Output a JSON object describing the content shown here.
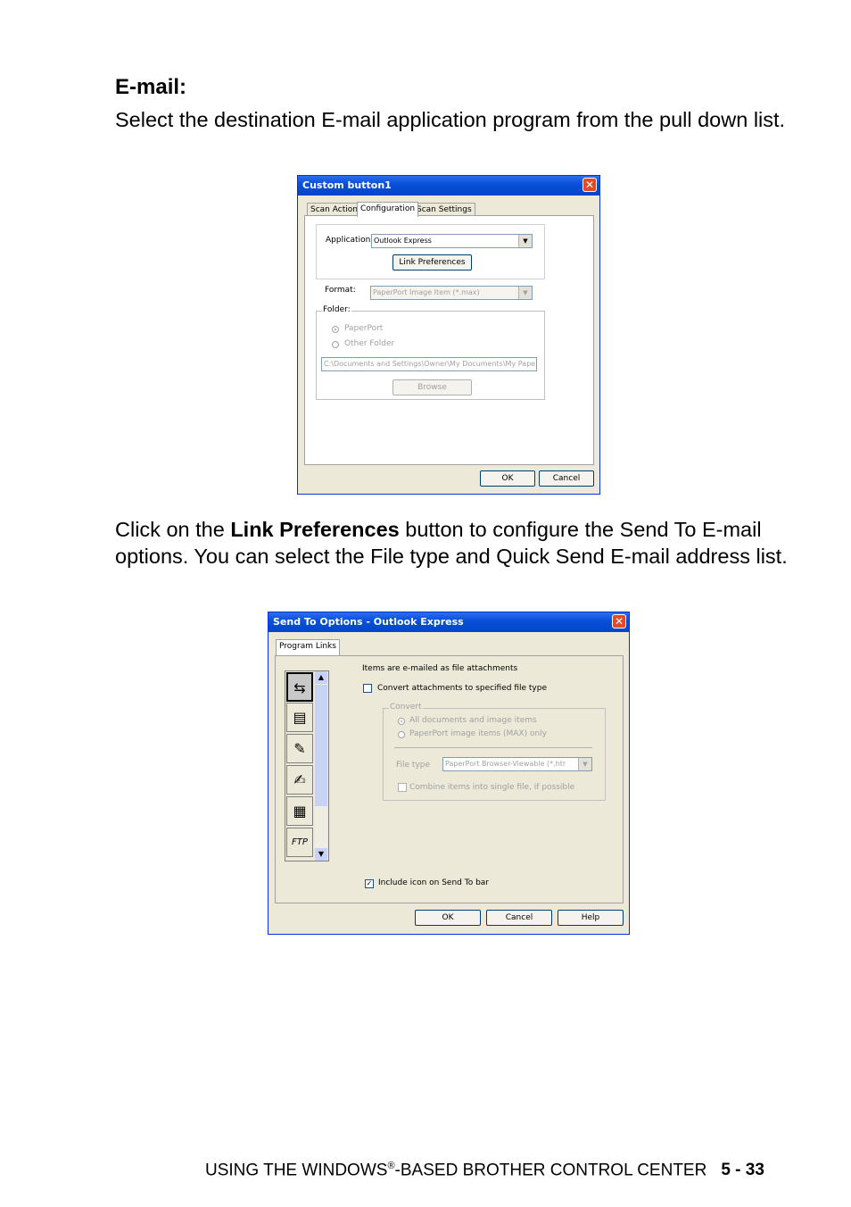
{
  "heading": "E-mail:",
  "para1": "Select the destination E-mail application program from the pull down list.",
  "para2": {
    "before": "Click on the ",
    "bold": "Link Preferences",
    "after": " button to configure the Send To E-mail options. You can select the File type and Quick Send E-mail address list."
  },
  "dialog1": {
    "title": "Custom button1",
    "tabs": [
      "Scan Action",
      "Configuration",
      "Scan Settings"
    ],
    "application_label": "Application:",
    "application_value": "Outlook Express",
    "link_prefs_button": "Link Preferences",
    "format_label": "Format:",
    "format_value": "PaperPort Image Item (*.max)",
    "folder_label": "Folder:",
    "radio_paperport": "PaperPort",
    "radio_other": "Other Folder",
    "folder_path": "C:\\Documents and Settings\\Owner\\My Documents\\My Pape",
    "browse_button": "Browse",
    "ok_button": "OK",
    "cancel_button": "Cancel"
  },
  "dialog2": {
    "title": "Send To Options - Outlook Express",
    "tab": "Program Links",
    "info_text": "Items are e-mailed as file attachments",
    "convert_checkbox": "Convert attachments to specified file type",
    "convert_group": "Convert",
    "radio_all": "All documents and image items",
    "radio_max": "PaperPort image items (MAX) only",
    "filetype_label": "File type",
    "filetype_value": "PaperPort Browser-Viewable (*.htr",
    "combine_checkbox": "Combine items into single file, if possible",
    "include_checkbox": "Include icon on Send To bar",
    "ok_button": "OK",
    "cancel_button": "Cancel",
    "help_button": "Help",
    "ftp_icon_text": "FTP"
  },
  "footer": {
    "text": "USING THE WINDOWS",
    "reg": "®",
    "text2": "-BASED BROTHER CONTROL CENTER",
    "page": "5 - 33"
  }
}
